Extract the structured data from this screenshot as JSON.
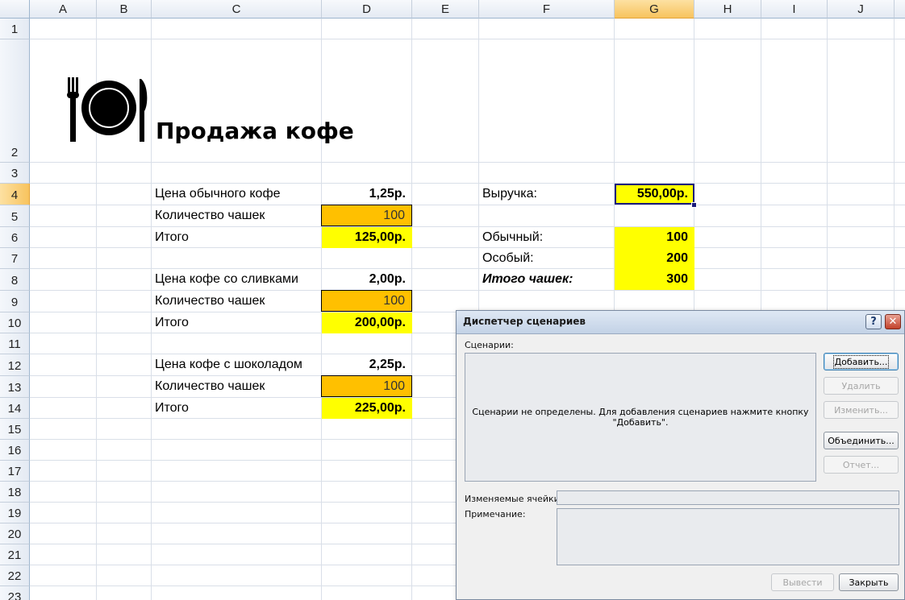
{
  "columns": [
    {
      "label": "A"
    },
    {
      "label": "B"
    },
    {
      "label": "C"
    },
    {
      "label": "D"
    },
    {
      "label": "E"
    },
    {
      "label": "F"
    },
    {
      "label": "G"
    },
    {
      "label": "H"
    },
    {
      "label": "I"
    },
    {
      "label": "J"
    }
  ],
  "rows": [
    "1",
    "2",
    "3",
    "4",
    "5",
    "6",
    "7",
    "8",
    "9",
    "10",
    "11",
    "12",
    "13",
    "14",
    "15",
    "16",
    "17",
    "18",
    "19",
    "20",
    "21",
    "22",
    "23"
  ],
  "sheet": {
    "title": "Продажа кофе",
    "logo_icon": "plate-fork-knife-icon",
    "regular_price_label": "Цена обычного кофе",
    "regular_price": "1,25р.",
    "regular_cups_label": "Количество чашек",
    "regular_cups": "100",
    "regular_total_label": "Итого",
    "regular_total": "125,00р.",
    "cream_price_label": "Цена кофе со сливками",
    "cream_price": "2,00р.",
    "cream_cups_label": "Количество чашек",
    "cream_cups": "100",
    "cream_total_label": "Итого",
    "cream_total": "200,00р.",
    "choc_price_label": "Цена кофе с шоколадом",
    "choc_price": "2,25р.",
    "choc_cups_label": "Количество чашек",
    "choc_cups": "100",
    "choc_total_label": "Итого",
    "choc_total": "225,00р.",
    "revenue_label": "Выручка:",
    "revenue": "550,00р.",
    "regular_label": "Обычный:",
    "regular_count": "100",
    "special_label": "Особый:",
    "special_count": "200",
    "cups_total_label": "Итого чашек:",
    "cups_total": "300"
  },
  "dialog": {
    "title": "Диспетчер сценариев",
    "help_label": "?",
    "close_label": "✕",
    "scenarios_label": "Сценарии:",
    "empty_message": "Сценарии не определены. Для добавления сценариев нажмите кнопку \"Добавить\".",
    "changing_cells_label": "Изменяемые ячейки:",
    "comment_label": "Примечание:",
    "buttons": {
      "add": "Добавить...",
      "delete": "Удалить",
      "edit": "Изменить...",
      "merge": "Объединить...",
      "report": "Отчет...",
      "show": "Вывести",
      "close": "Закрыть"
    }
  },
  "colors": {
    "input_fill": "#ffc000",
    "output_fill": "#ffff00",
    "active_cell_border": "#1c1c7a",
    "header_selected": "#f7c35e"
  }
}
